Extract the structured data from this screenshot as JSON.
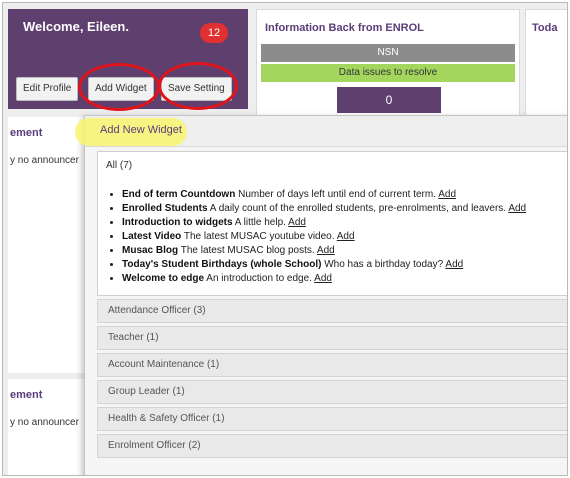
{
  "welcome": {
    "title": "Welcome, Eileen.",
    "badge_count": "12",
    "buttons": {
      "edit_profile": "Edit Profile",
      "add_widget": "Add Widget",
      "save_setting": "Save Setting"
    }
  },
  "enrol": {
    "title": "Information Back from ENROL",
    "nsn": "NSN",
    "issues": "Data issues to resolve",
    "count": "0"
  },
  "today": {
    "title": "Toda"
  },
  "left_fragments": [
    {
      "heading": "ement",
      "text": "y no announcer"
    },
    {
      "heading": "ement",
      "text": "y no announcer"
    }
  ],
  "dialog": {
    "title": "Add New Widget",
    "all_label": "All (7)",
    "add_label": "Add",
    "widgets": [
      {
        "name": "End of term Countdown",
        "desc": "Number of days left until end of current term."
      },
      {
        "name": "Enrolled Students",
        "desc": "A daily count of the enrolled students, pre-enrolments, and leavers."
      },
      {
        "name": "Introduction to widgets",
        "desc": "A little help."
      },
      {
        "name": "Latest Video",
        "desc": "The latest MUSAC youtube video."
      },
      {
        "name": "Musac Blog",
        "desc": "The latest MUSAC blog posts."
      },
      {
        "name": "Today's Student Birthdays (whole School)",
        "desc": "Who has a birthday today?"
      },
      {
        "name": "Welcome to edge",
        "desc": "An introduction to edge."
      }
    ],
    "categories": [
      "Attendance Officer (3)",
      "Teacher (1)",
      "Account Maintenance (1)",
      "Group Leader (1)",
      "Health & Safety Officer (1)",
      "Enrolment Officer (2)"
    ]
  },
  "colors": {
    "brand_purple": "#5f3f6e",
    "badge_red": "#e03030",
    "annotation_red": "#e0141a",
    "highlight_yellow": "#f8f46e",
    "issues_green": "#a4d65e"
  }
}
